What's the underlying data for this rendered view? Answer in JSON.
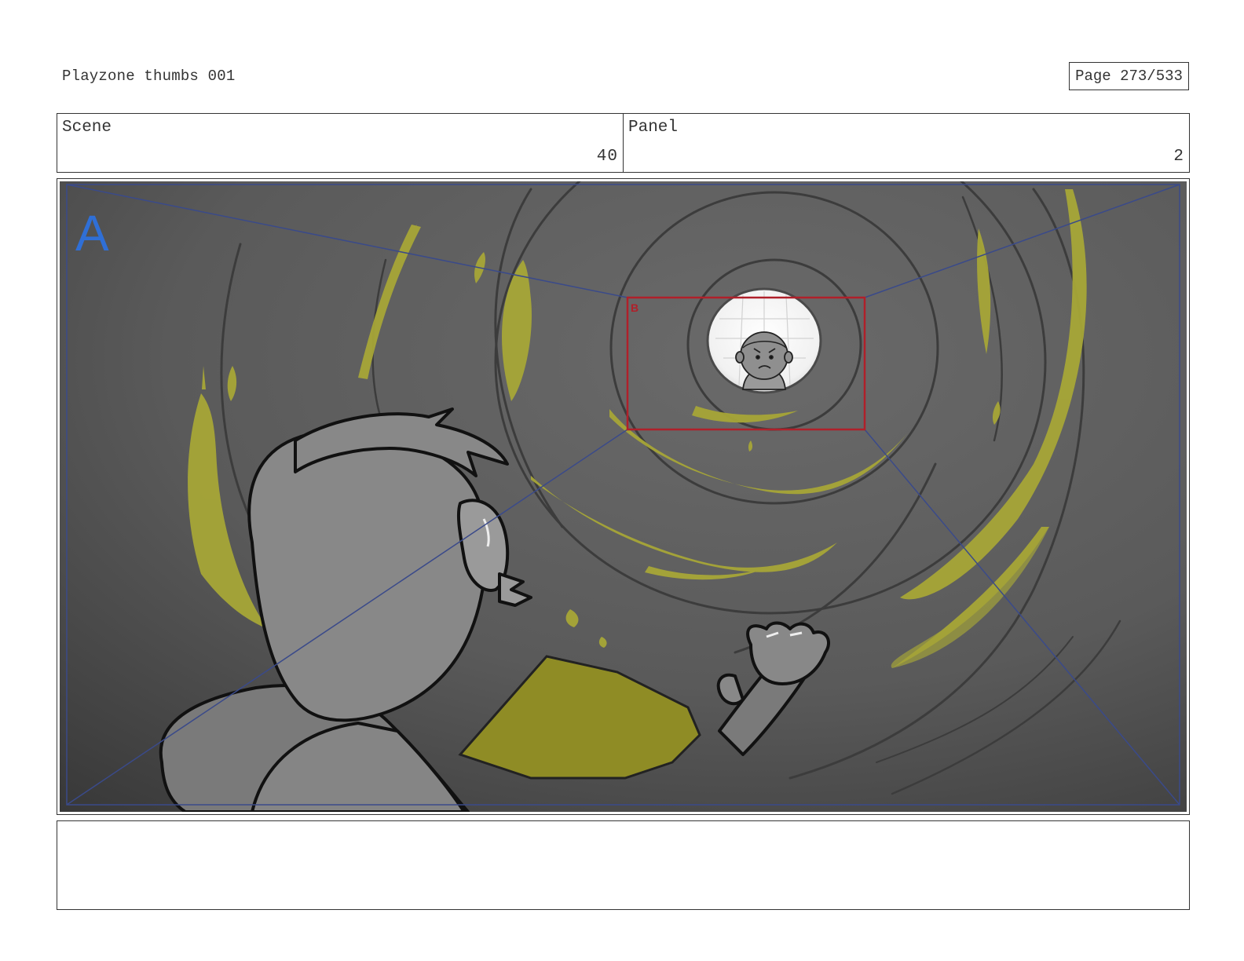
{
  "header": {
    "title": "Playzone thumbs 001",
    "page": "Page 273/533"
  },
  "info": {
    "scene_label": "Scene",
    "scene_value": "40",
    "panel_label": "Panel",
    "panel_value": "2"
  },
  "frame": {
    "camera_a_label": "A",
    "camera_b_label": "B",
    "colors": {
      "background": "#5a5a5a",
      "accent": "#a7a637",
      "camera_a": "#2f6fd6",
      "camera_b": "#b0202a"
    }
  },
  "notes": {
    "text": ""
  }
}
